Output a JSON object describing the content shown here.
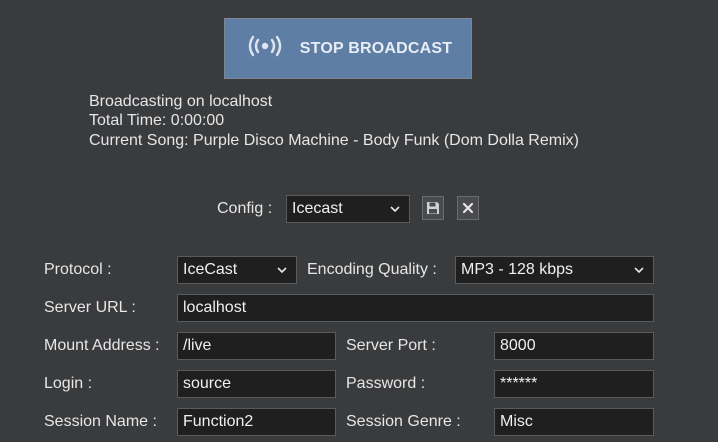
{
  "broadcast": {
    "button_label": "STOP BROADCAST",
    "icon": "broadcast-waves-icon",
    "button_color": "#5f7ea6"
  },
  "status": {
    "line1": "Broadcasting on localhost",
    "line2": "Total Time: 0:00:00",
    "line3": "Current Song: Purple Disco Machine - Body Funk (Dom Dolla Remix)"
  },
  "config": {
    "label": "Config :",
    "value": "Icecast",
    "save_icon": "save-icon",
    "delete_icon": "close-icon"
  },
  "form": {
    "protocol": {
      "label": "Protocol :",
      "value": "IceCast"
    },
    "encoding": {
      "label": "Encoding Quality :",
      "value": "MP3 - 128 kbps"
    },
    "server_url": {
      "label": "Server URL :",
      "value": "localhost"
    },
    "mount": {
      "label": "Mount Address :",
      "value": "/live"
    },
    "port": {
      "label": "Server Port :",
      "value": "8000"
    },
    "login": {
      "label": "Login :",
      "value": "source"
    },
    "password": {
      "label": "Password :",
      "value": "******"
    },
    "session_name": {
      "label": "Session Name :",
      "value": "Function2"
    },
    "session_genre": {
      "label": "Session Genre :",
      "value": "Misc"
    }
  },
  "colors": {
    "background": "#3a3b3d",
    "field_background": "#1f1f20",
    "text": "#e6e6e6"
  }
}
